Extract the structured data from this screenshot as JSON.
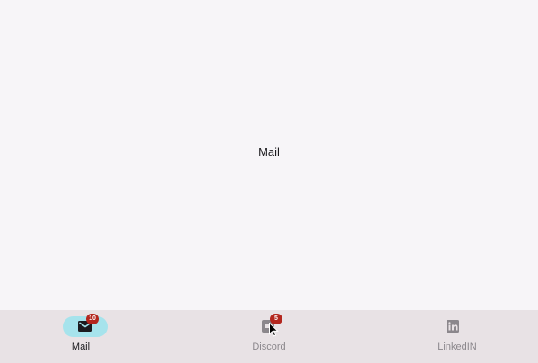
{
  "content": {
    "title": "Mail"
  },
  "navbar": {
    "items": [
      {
        "label": "Mail",
        "icon": "mail-icon",
        "badge": "10",
        "active": true
      },
      {
        "label": "Discord",
        "icon": "discord-icon",
        "badge": "5",
        "active": false
      },
      {
        "label": "LinkedIN",
        "icon": "linkedin-icon",
        "badge": "",
        "active": false
      }
    ]
  },
  "colors": {
    "background": "#f7f5f8",
    "navbar": "#e8e2e5",
    "active_indicator": "#a6e3ec",
    "badge": "#b3261e",
    "active_text": "#1c1b1f",
    "inactive": "#8b878c"
  }
}
